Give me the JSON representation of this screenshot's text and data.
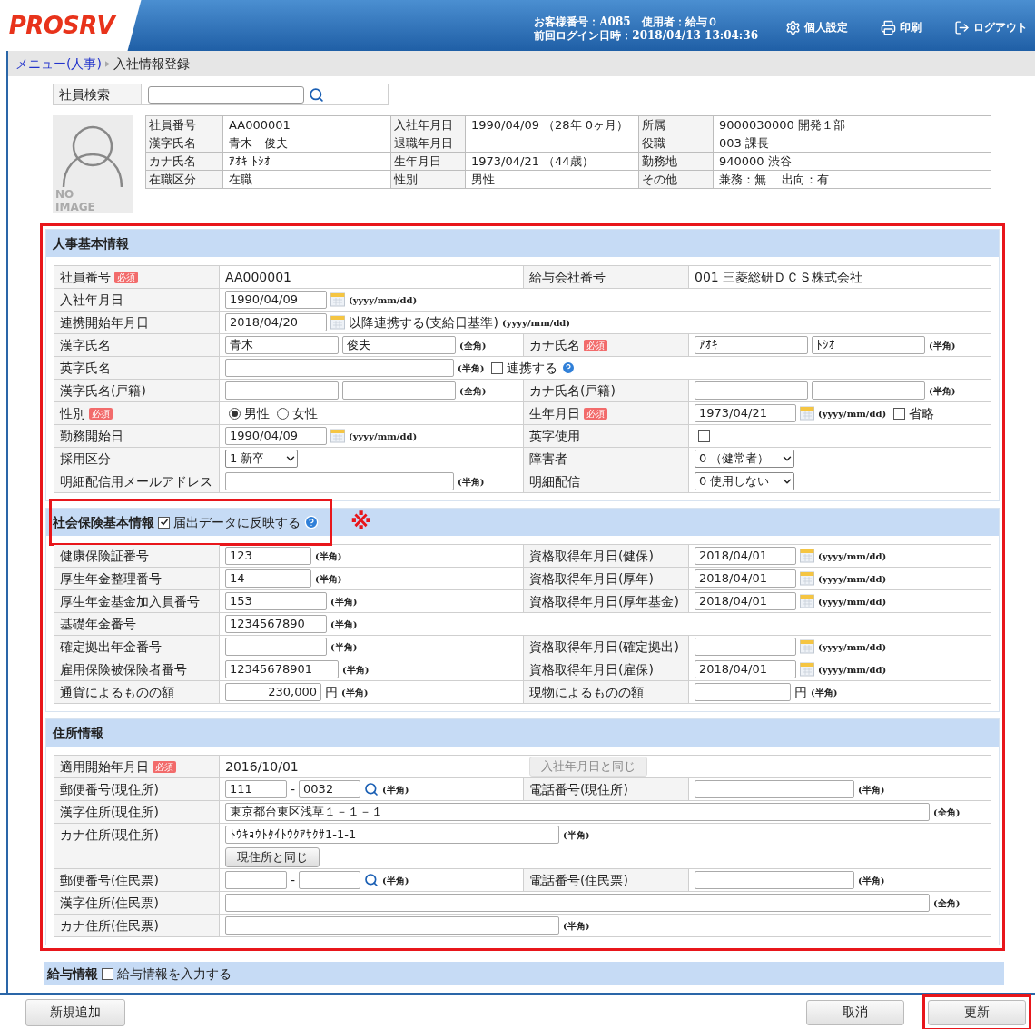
{
  "header": {
    "logo": "PROSRV",
    "customer_line": "お客様番号：A085　使用者：給与０",
    "login_line": "前回ログイン日時：2018/04/13 13:04:36",
    "actions": [
      {
        "label": "個人設定"
      },
      {
        "label": "印刷"
      },
      {
        "label": "ログアウト"
      }
    ]
  },
  "breadcrumb": [
    {
      "label": "メニュー(人事)",
      "link": true
    },
    {
      "label": "入社情報登録",
      "link": false
    }
  ],
  "search": {
    "label": "社員検索"
  },
  "photo": {
    "text": "NO IMAGE"
  },
  "employee_info": [
    [
      {
        "label": "社員番号",
        "value": "AA000001"
      },
      {
        "label": "入社年月日",
        "value": "1990/04/09 （28年 0ヶ月）"
      },
      {
        "label": "所属",
        "value": "9000030000 開発１部"
      }
    ],
    [
      {
        "label": "漢字氏名",
        "value": "青木　俊夫"
      },
      {
        "label": "退職年月日"
      },
      {
        "label": "役職",
        "value": "003 課長"
      }
    ],
    [
      {
        "label": "カナ氏名",
        "value": "ｱｵｷ ﾄｼｵ"
      },
      {
        "label": "生年月日",
        "value": "1973/04/21 （44歳）"
      },
      {
        "label": "勤務地",
        "value": "940000 渋谷"
      }
    ],
    [
      {
        "label": "在職区分",
        "value": "在職"
      },
      {
        "label": "性別",
        "value": "男性"
      },
      {
        "label": "その他",
        "value": "兼務：無　 出向：有"
      }
    ]
  ],
  "sections": [
    {
      "title": "人事基本情報",
      "rows": [
        {
          "left": {
            "label": "社員番号",
            "badge": "必須",
            "controls": [
              {
                "kind": "text",
                "text": "AA000001"
              }
            ]
          },
          "right": {
            "label": "給与会社番号",
            "controls": [
              {
                "kind": "text",
                "text": "001 三菱総研ＤＣＳ株式会社"
              }
            ]
          }
        },
        {
          "left": {
            "label": "入社年月日",
            "controls": [
              {
                "kind": "date_input",
                "value": "1990/04/09"
              },
              {
                "kind": "calendar"
              },
              {
                "kind": "note",
                "text": "(yyyy/mm/dd)"
              }
            ]
          }
        },
        {
          "left": {
            "label": "連携開始年月日",
            "controls": [
              {
                "kind": "date_input",
                "value": "2018/04/20"
              },
              {
                "kind": "calendar"
              },
              {
                "kind": "text",
                "text": "以降連携する(支給日基準)"
              },
              {
                "kind": "note",
                "text": "(yyyy/mm/dd)"
              }
            ]
          }
        },
        {
          "left": {
            "label": "漢字氏名",
            "controls": [
              {
                "kind": "name_input",
                "value": "青木"
              },
              {
                "kind": "name_input",
                "value": "俊夫"
              },
              {
                "kind": "note",
                "text": "(全角)"
              }
            ]
          },
          "right": {
            "label": "カナ氏名",
            "badge": "必須",
            "controls": [
              {
                "kind": "name_input",
                "value": "ｱｵｷ"
              },
              {
                "kind": "name_input",
                "value": "ﾄｼｵ"
              },
              {
                "kind": "note",
                "text": "(半角)"
              }
            ]
          }
        },
        {
          "left": {
            "label": "英字氏名",
            "controls": [
              {
                "kind": "email_input"
              },
              {
                "kind": "note",
                "text": "(半角)"
              },
              {
                "kind": "check",
                "checked": false,
                "label": "連携する"
              },
              {
                "kind": "help"
              }
            ]
          }
        },
        {
          "left": {
            "label": "漢字氏名(戸籍)",
            "controls": [
              {
                "kind": "name_input"
              },
              {
                "kind": "name_input"
              },
              {
                "kind": "note",
                "text": "(全角)"
              }
            ]
          },
          "right": {
            "label": "カナ氏名(戸籍)",
            "controls": [
              {
                "kind": "name_input"
              },
              {
                "kind": "name_input"
              },
              {
                "kind": "note",
                "text": "(半角)"
              }
            ]
          }
        },
        {
          "left": {
            "label": "性別",
            "badge": "必須",
            "controls": [
              {
                "kind": "radio",
                "selected": true,
                "label": "男性"
              },
              {
                "kind": "radio",
                "selected": false,
                "label": "女性"
              }
            ]
          },
          "right": {
            "label": "生年月日",
            "badge": "必須",
            "controls": [
              {
                "kind": "date_input",
                "value": "1973/04/21"
              },
              {
                "kind": "calendar"
              },
              {
                "kind": "note",
                "text": "(yyyy/mm/dd)"
              },
              {
                "kind": "check",
                "checked": false,
                "label": "省略"
              }
            ]
          }
        },
        {
          "left": {
            "label": "勤務開始日",
            "controls": [
              {
                "kind": "date_input",
                "value": "1990/04/09"
              },
              {
                "kind": "calendar"
              },
              {
                "kind": "note",
                "text": "(yyyy/mm/dd)"
              }
            ]
          },
          "right": {
            "label": "英字使用",
            "controls": [
              {
                "kind": "check",
                "checked": false
              }
            ]
          }
        },
        {
          "left": {
            "label": "採用区分",
            "controls": [
              {
                "kind": "select",
                "value": "1 新卒"
              }
            ]
          },
          "right": {
            "label": "障害者",
            "controls": [
              {
                "kind": "wide_select",
                "value": "0 （健常者）"
              }
            ]
          }
        },
        {
          "left": {
            "label": "明細配信用メールアドレス",
            "controls": [
              {
                "kind": "email_input"
              },
              {
                "kind": "note",
                "text": "(半角)"
              }
            ]
          },
          "right": {
            "label": "明細配信",
            "controls": [
              {
                "kind": "wide_select",
                "value": "0 使用しない"
              }
            ]
          }
        }
      ]
    },
    {
      "title": "社会保険基本情報",
      "option": {
        "checked": true,
        "label": "届出データに反映する"
      },
      "annotation": "※",
      "rows": [
        {
          "left": {
            "label": "健康保険証番号",
            "controls": [
              {
                "kind": "number_input",
                "value": "123"
              },
              {
                "kind": "note",
                "text": "(半角)"
              }
            ]
          },
          "right": {
            "label": "資格取得年月日(健保)",
            "controls": [
              {
                "kind": "date_input",
                "value": "2018/04/01"
              },
              {
                "kind": "calendar"
              },
              {
                "kind": "note",
                "text": "(yyyy/mm/dd)"
              }
            ]
          }
        },
        {
          "left": {
            "label": "厚生年金整理番号",
            "controls": [
              {
                "kind": "number_input",
                "value": "14"
              },
              {
                "kind": "note",
                "text": "(半角)"
              }
            ]
          },
          "right": {
            "label": "資格取得年月日(厚年)",
            "controls": [
              {
                "kind": "date_input",
                "value": "2018/04/01"
              },
              {
                "kind": "calendar"
              },
              {
                "kind": "note",
                "text": "(yyyy/mm/dd)"
              }
            ]
          }
        },
        {
          "left": {
            "label": "厚生年金基金加入員番号",
            "controls": [
              {
                "kind": "date_input",
                "value": "153"
              },
              {
                "kind": "note",
                "text": "(半角)"
              }
            ]
          },
          "right": {
            "label": "資格取得年月日(厚年基金)",
            "controls": [
              {
                "kind": "date_input",
                "value": "2018/04/01"
              },
              {
                "kind": "calendar"
              },
              {
                "kind": "note",
                "text": "(yyyy/mm/dd)"
              }
            ]
          }
        },
        {
          "left": {
            "label": "基礎年金番号",
            "controls": [
              {
                "kind": "date_input",
                "value": "1234567890"
              },
              {
                "kind": "note",
                "text": "(半角)"
              }
            ]
          }
        },
        {
          "left": {
            "label": "確定拠出年金番号",
            "controls": [
              {
                "kind": "date_input"
              },
              {
                "kind": "note",
                "text": "(半角)"
              }
            ]
          },
          "right": {
            "label": "資格取得年月日(確定拠出)",
            "controls": [
              {
                "kind": "date_input"
              },
              {
                "kind": "calendar"
              },
              {
                "kind": "note",
                "text": "(yyyy/mm/dd)"
              }
            ]
          }
        },
        {
          "left": {
            "label": "雇用保険被保険者番号",
            "controls": [
              {
                "kind": "name_input",
                "value": "12345678901"
              },
              {
                "kind": "note",
                "text": "(半角)"
              }
            ]
          },
          "right": {
            "label": "資格取得年月日(雇保)",
            "controls": [
              {
                "kind": "date_input",
                "value": "2018/04/01"
              },
              {
                "kind": "calendar"
              },
              {
                "kind": "note",
                "text": "(yyyy/mm/dd)"
              }
            ]
          }
        },
        {
          "left": {
            "label": "通貨によるものの額",
            "controls": [
              {
                "kind": "amount_input",
                "value": "230,000"
              },
              {
                "kind": "text",
                "text": "円"
              },
              {
                "kind": "note",
                "text": "(半角)"
              }
            ]
          },
          "right": {
            "label": "現物によるものの額",
            "controls": [
              {
                "kind": "amount_input"
              },
              {
                "kind": "text",
                "text": "円"
              },
              {
                "kind": "note",
                "text": "(半角)"
              }
            ]
          }
        }
      ]
    },
    {
      "title": "住所情報",
      "rows": [
        {
          "left": {
            "label": "適用開始年月日",
            "badge": "必須",
            "controls": [
              {
                "kind": "text",
                "text": "2016/10/01"
              },
              {
                "kind": "button",
                "label": "入社年月日と同じ",
                "disabled": true
              }
            ]
          }
        },
        {
          "left": {
            "label": "郵便番号(現住所)",
            "controls": [
              {
                "kind": "short_input",
                "value": "111"
              },
              {
                "kind": "text",
                "text": "-"
              },
              {
                "kind": "short_input",
                "value": "0032"
              },
              {
                "kind": "search"
              },
              {
                "kind": "note",
                "text": "(半角)"
              }
            ]
          },
          "right": {
            "label": "電話番号(現住所)",
            "controls": [
              {
                "kind": "phone_input"
              },
              {
                "kind": "note",
                "text": "(半角)"
              }
            ]
          }
        },
        {
          "left": {
            "label": "漢字住所(現住所)",
            "controls": [
              {
                "kind": "wide_input",
                "value": "東京都台東区浅草１－１－１"
              },
              {
                "kind": "note",
                "text": "(全角)"
              }
            ]
          }
        },
        {
          "left": {
            "label": "カナ住所(現住所)",
            "controls": [
              {
                "kind": "address_input",
                "value": "ﾄｳｷｮｳﾄﾀｲﾄｳｸｱｻｸｻ1-1-1"
              },
              {
                "kind": "note",
                "text": "(半角)"
              }
            ]
          }
        },
        {
          "left": {
            "controls": [
              {
                "kind": "button",
                "label": "現住所と同じ",
                "disabled": false
              }
            ]
          }
        },
        {
          "left": {
            "label": "郵便番号(住民票)",
            "controls": [
              {
                "kind": "short_input"
              },
              {
                "kind": "text",
                "text": "-"
              },
              {
                "kind": "short_input"
              },
              {
                "kind": "search"
              },
              {
                "kind": "note",
                "text": "(半角)"
              }
            ]
          },
          "right": {
            "label": "電話番号(住民票)",
            "controls": [
              {
                "kind": "phone_input"
              },
              {
                "kind": "note",
                "text": "(半角)"
              }
            ]
          }
        },
        {
          "left": {
            "label": "漢字住所(住民票)",
            "controls": [
              {
                "kind": "wide_input"
              },
              {
                "kind": "note",
                "text": "(全角)"
              }
            ]
          }
        },
        {
          "left": {
            "label": "カナ住所(住民票)",
            "controls": [
              {
                "kind": "address_input"
              },
              {
                "kind": "note",
                "text": "(半角)"
              }
            ]
          }
        }
      ]
    }
  ],
  "partial_section": {
    "title": "給与情報",
    "option": {
      "checked": false,
      "label": "給与情報を入力する"
    }
  },
  "footer": {
    "left_buttons": [
      {
        "label": "新規追加",
        "highlighted": false
      }
    ],
    "right_buttons": [
      {
        "label": "取消",
        "highlighted": false
      },
      {
        "label": "更新",
        "highlighted": true
      }
    ]
  }
}
